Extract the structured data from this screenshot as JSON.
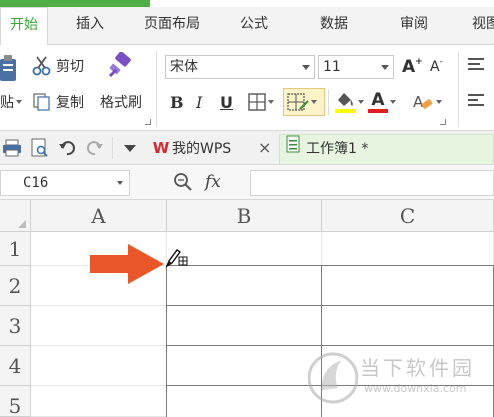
{
  "tabs": [
    {
      "label": "开始",
      "active": true
    },
    {
      "label": "插入"
    },
    {
      "label": "页面布局"
    },
    {
      "label": "公式"
    },
    {
      "label": "数据"
    },
    {
      "label": "审阅"
    },
    {
      "label": "视图"
    }
  ],
  "clipboard": {
    "paste_label": "粘贴",
    "cut_label": "剪切",
    "copy_label": "复制",
    "format_painter_label": "格式刷"
  },
  "font": {
    "name": "宋体",
    "size": "11",
    "grow_label": "A",
    "shrink_label": "A",
    "bold_label": "B",
    "italic_label": "I",
    "underline_label": "U",
    "font_color_label": "A",
    "font_color": "#e02020",
    "fill_color": "#ffff00"
  },
  "quickbar": {
    "wps_tab_label": "我的WPS",
    "close_label": "×",
    "doc_tab_label": "工作簿1 *",
    "wps_color": "#d9262c"
  },
  "formula_bar": {
    "cell_ref": "C16",
    "fx_label": "fx"
  },
  "grid": {
    "columns": [
      "A",
      "B",
      "C"
    ],
    "rows": [
      "1",
      "2",
      "3",
      "4",
      "5"
    ]
  },
  "arrow_color": "#e8562a",
  "accent_color": "#36a836",
  "watermark": {
    "title": "当下软件园",
    "url": "www.downxia.com"
  }
}
